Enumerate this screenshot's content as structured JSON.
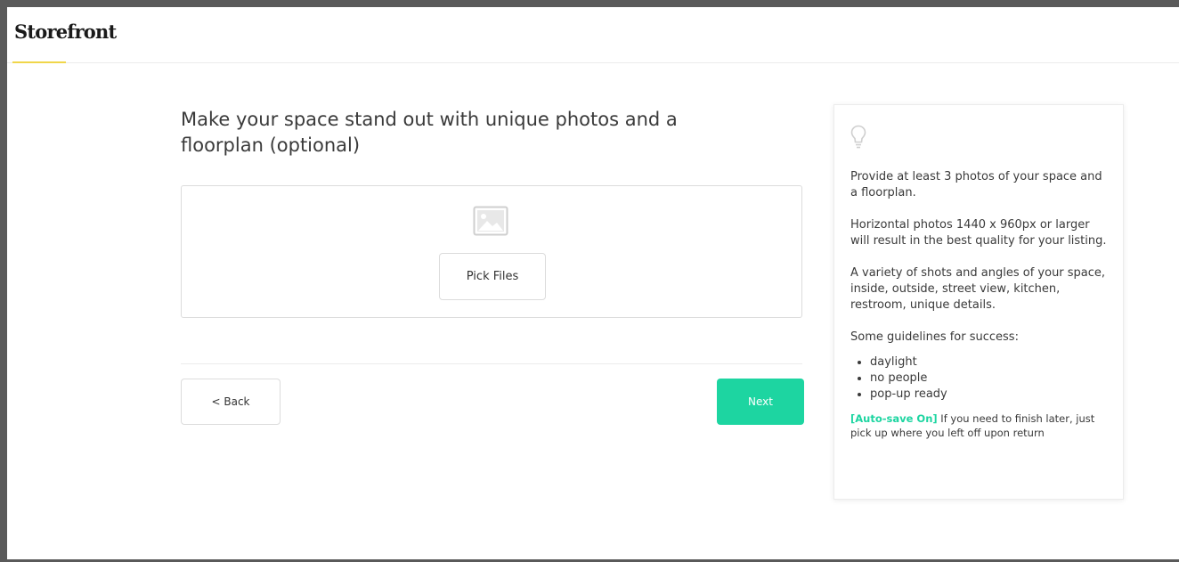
{
  "header": {
    "logo": "Storefront"
  },
  "main": {
    "title": "Make your space stand out with unique photos and a floorplan (optional)",
    "upload": {
      "icon": "image-icon",
      "pick_label": "Pick Files"
    },
    "nav": {
      "back_label": "< Back",
      "next_label": "Next"
    }
  },
  "tips": {
    "icon": "lightbulb-icon",
    "paragraphs": [
      "Provide at least 3 photos of your space and a floorplan.",
      "Horizontal photos 1440 x 960px or larger will result in the best quality for your listing.",
      "A variety of shots and angles of your space, inside, outside, street view, kitchen, restroom, unique details.",
      "Some guidelines for success:"
    ],
    "guidelines": [
      "daylight",
      "no people",
      "pop-up ready"
    ],
    "autosave_tag": "[Auto-save On]",
    "autosave_text": " If you need to finish later, just pick up where you left off upon return"
  },
  "colors": {
    "accent": "#1dd5a1",
    "logo_underline": "#f0d64a"
  }
}
